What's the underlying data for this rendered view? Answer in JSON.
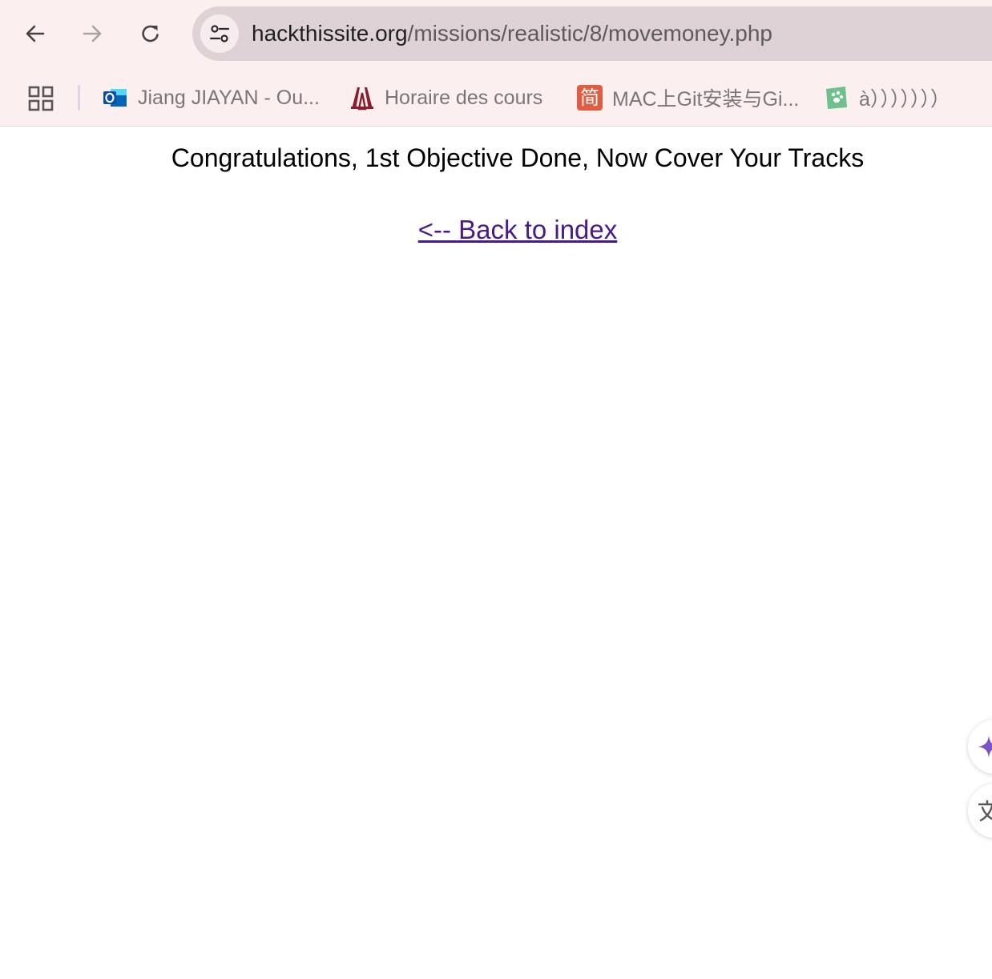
{
  "browser": {
    "url_host": "hackthissite.org",
    "url_path": "/missions/realistic/8/movemoney.php",
    "bookmarks": [
      {
        "label": "Jiang JIAYAN - Ou...",
        "icon": "outlook-icon"
      },
      {
        "label": "Horaire des cours",
        "icon": "university-logo-icon"
      },
      {
        "label": "MAC上Git安装与Gi...",
        "icon": "jianshu-icon",
        "icon_text": "简"
      },
      {
        "label": "à）））））））",
        "icon": "paw-icon"
      }
    ],
    "colors": {
      "toolbar_bg": "#fcefef",
      "omnibox_bg": "#ded2d6",
      "link_visited": "#4a1a8a"
    }
  },
  "page": {
    "message": "Congratulations, 1st Objective Done, Now Cover Your Tracks",
    "back_link": "<-- Back to index"
  }
}
